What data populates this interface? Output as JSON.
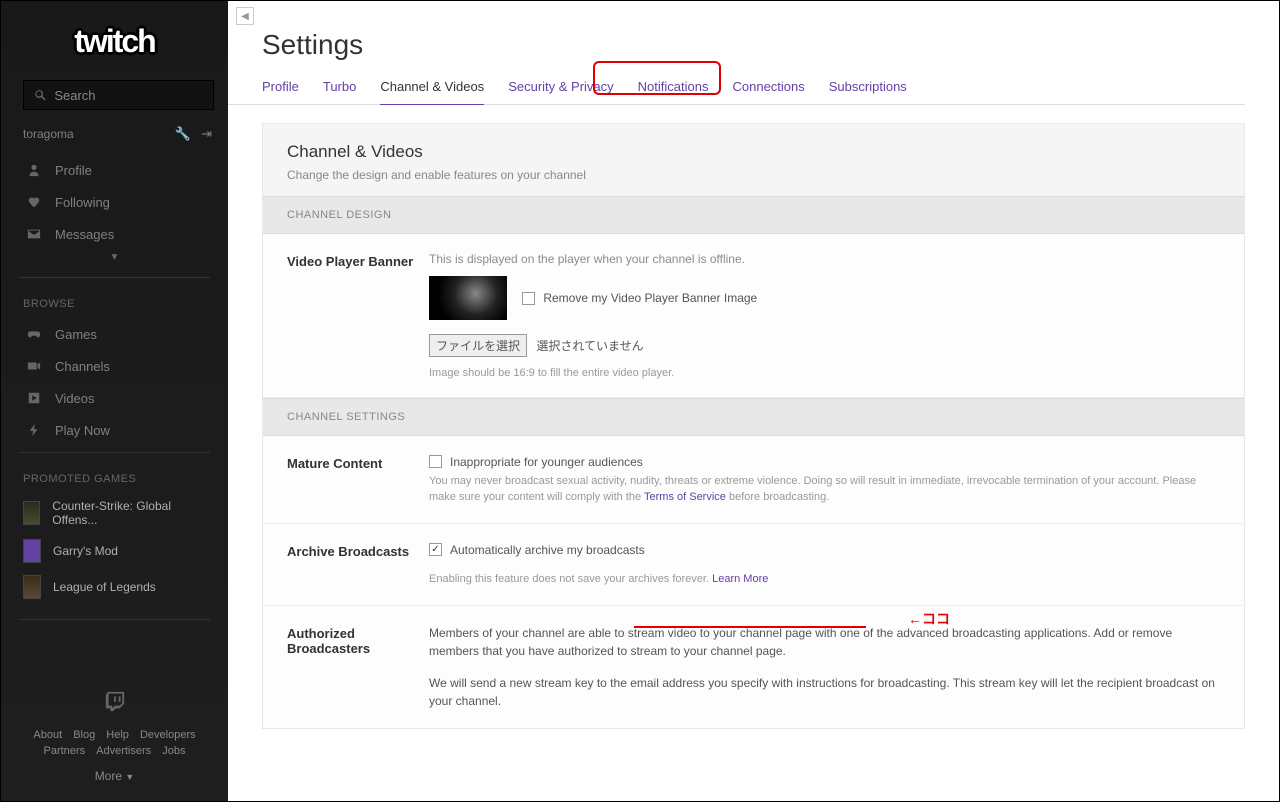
{
  "sidebar": {
    "search_placeholder": "Search",
    "username": "toragoma",
    "user_nav": [
      {
        "icon": "person",
        "label": "Profile"
      },
      {
        "icon": "heart",
        "label": "Following"
      },
      {
        "icon": "envelope",
        "label": "Messages"
      }
    ],
    "browse_label": "BROWSE",
    "browse_nav": [
      {
        "icon": "controller",
        "label": "Games"
      },
      {
        "icon": "camera",
        "label": "Channels"
      },
      {
        "icon": "play",
        "label": "Videos"
      },
      {
        "icon": "bolt",
        "label": "Play Now"
      }
    ],
    "promoted_label": "PROMOTED GAMES",
    "promoted_games": [
      {
        "thumb": "cs",
        "label": "Counter-Strike: Global Offens..."
      },
      {
        "thumb": "gm",
        "label": "Garry's Mod"
      },
      {
        "thumb": "lol",
        "label": "League of Legends"
      }
    ],
    "footer_links_row1": [
      "About",
      "Blog",
      "Help",
      "Developers"
    ],
    "footer_links_row2": [
      "Partners",
      "Advertisers",
      "Jobs"
    ],
    "more_label": "More"
  },
  "page_title": "Settings",
  "tabs": [
    "Profile",
    "Turbo",
    "Channel & Videos",
    "Security & Privacy",
    "Notifications",
    "Connections",
    "Subscriptions"
  ],
  "active_tab": "Channel & Videos",
  "panel": {
    "title": "Channel & Videos",
    "subtitle": "Change the design and enable features on your channel",
    "section_design": "CHANNEL DESIGN",
    "section_settings": "CHANNEL SETTINGS",
    "video_banner": {
      "label": "Video Player Banner",
      "desc": "This is displayed on the player when your channel is offline.",
      "remove_label": "Remove my Video Player Banner Image",
      "file_btn": "ファイルを選択",
      "file_status": "選択されていません",
      "hint": "Image should be 16:9 to fill the entire video player."
    },
    "mature": {
      "label": "Mature Content",
      "cb_label": "Inappropriate for younger audiences",
      "policy_pre": "You may never broadcast sexual activity, nudity, threats or extreme violence. Doing so will result in immediate, irrevocable termination of your account. Please make sure your content will comply with the ",
      "policy_link": "Terms of Service",
      "policy_post": " before broadcasting."
    },
    "archive": {
      "label": "Archive Broadcasts",
      "cb_label": "Automatically archive my broadcasts",
      "hint_pre": "Enabling this feature does not save your archives forever. ",
      "hint_link": "Learn More"
    },
    "authorized": {
      "label": "Authorized Broadcasters",
      "p1": "Members of your channel are able to stream video to your channel page with one of the advanced broadcasting applications. Add or remove members that you have authorized to stream to your channel page.",
      "p2": "We will send a new stream key to the email address you specify with instructions for broadcasting. This stream key will let the recipient broadcast on your channel."
    }
  },
  "annot_text": "←ココ"
}
